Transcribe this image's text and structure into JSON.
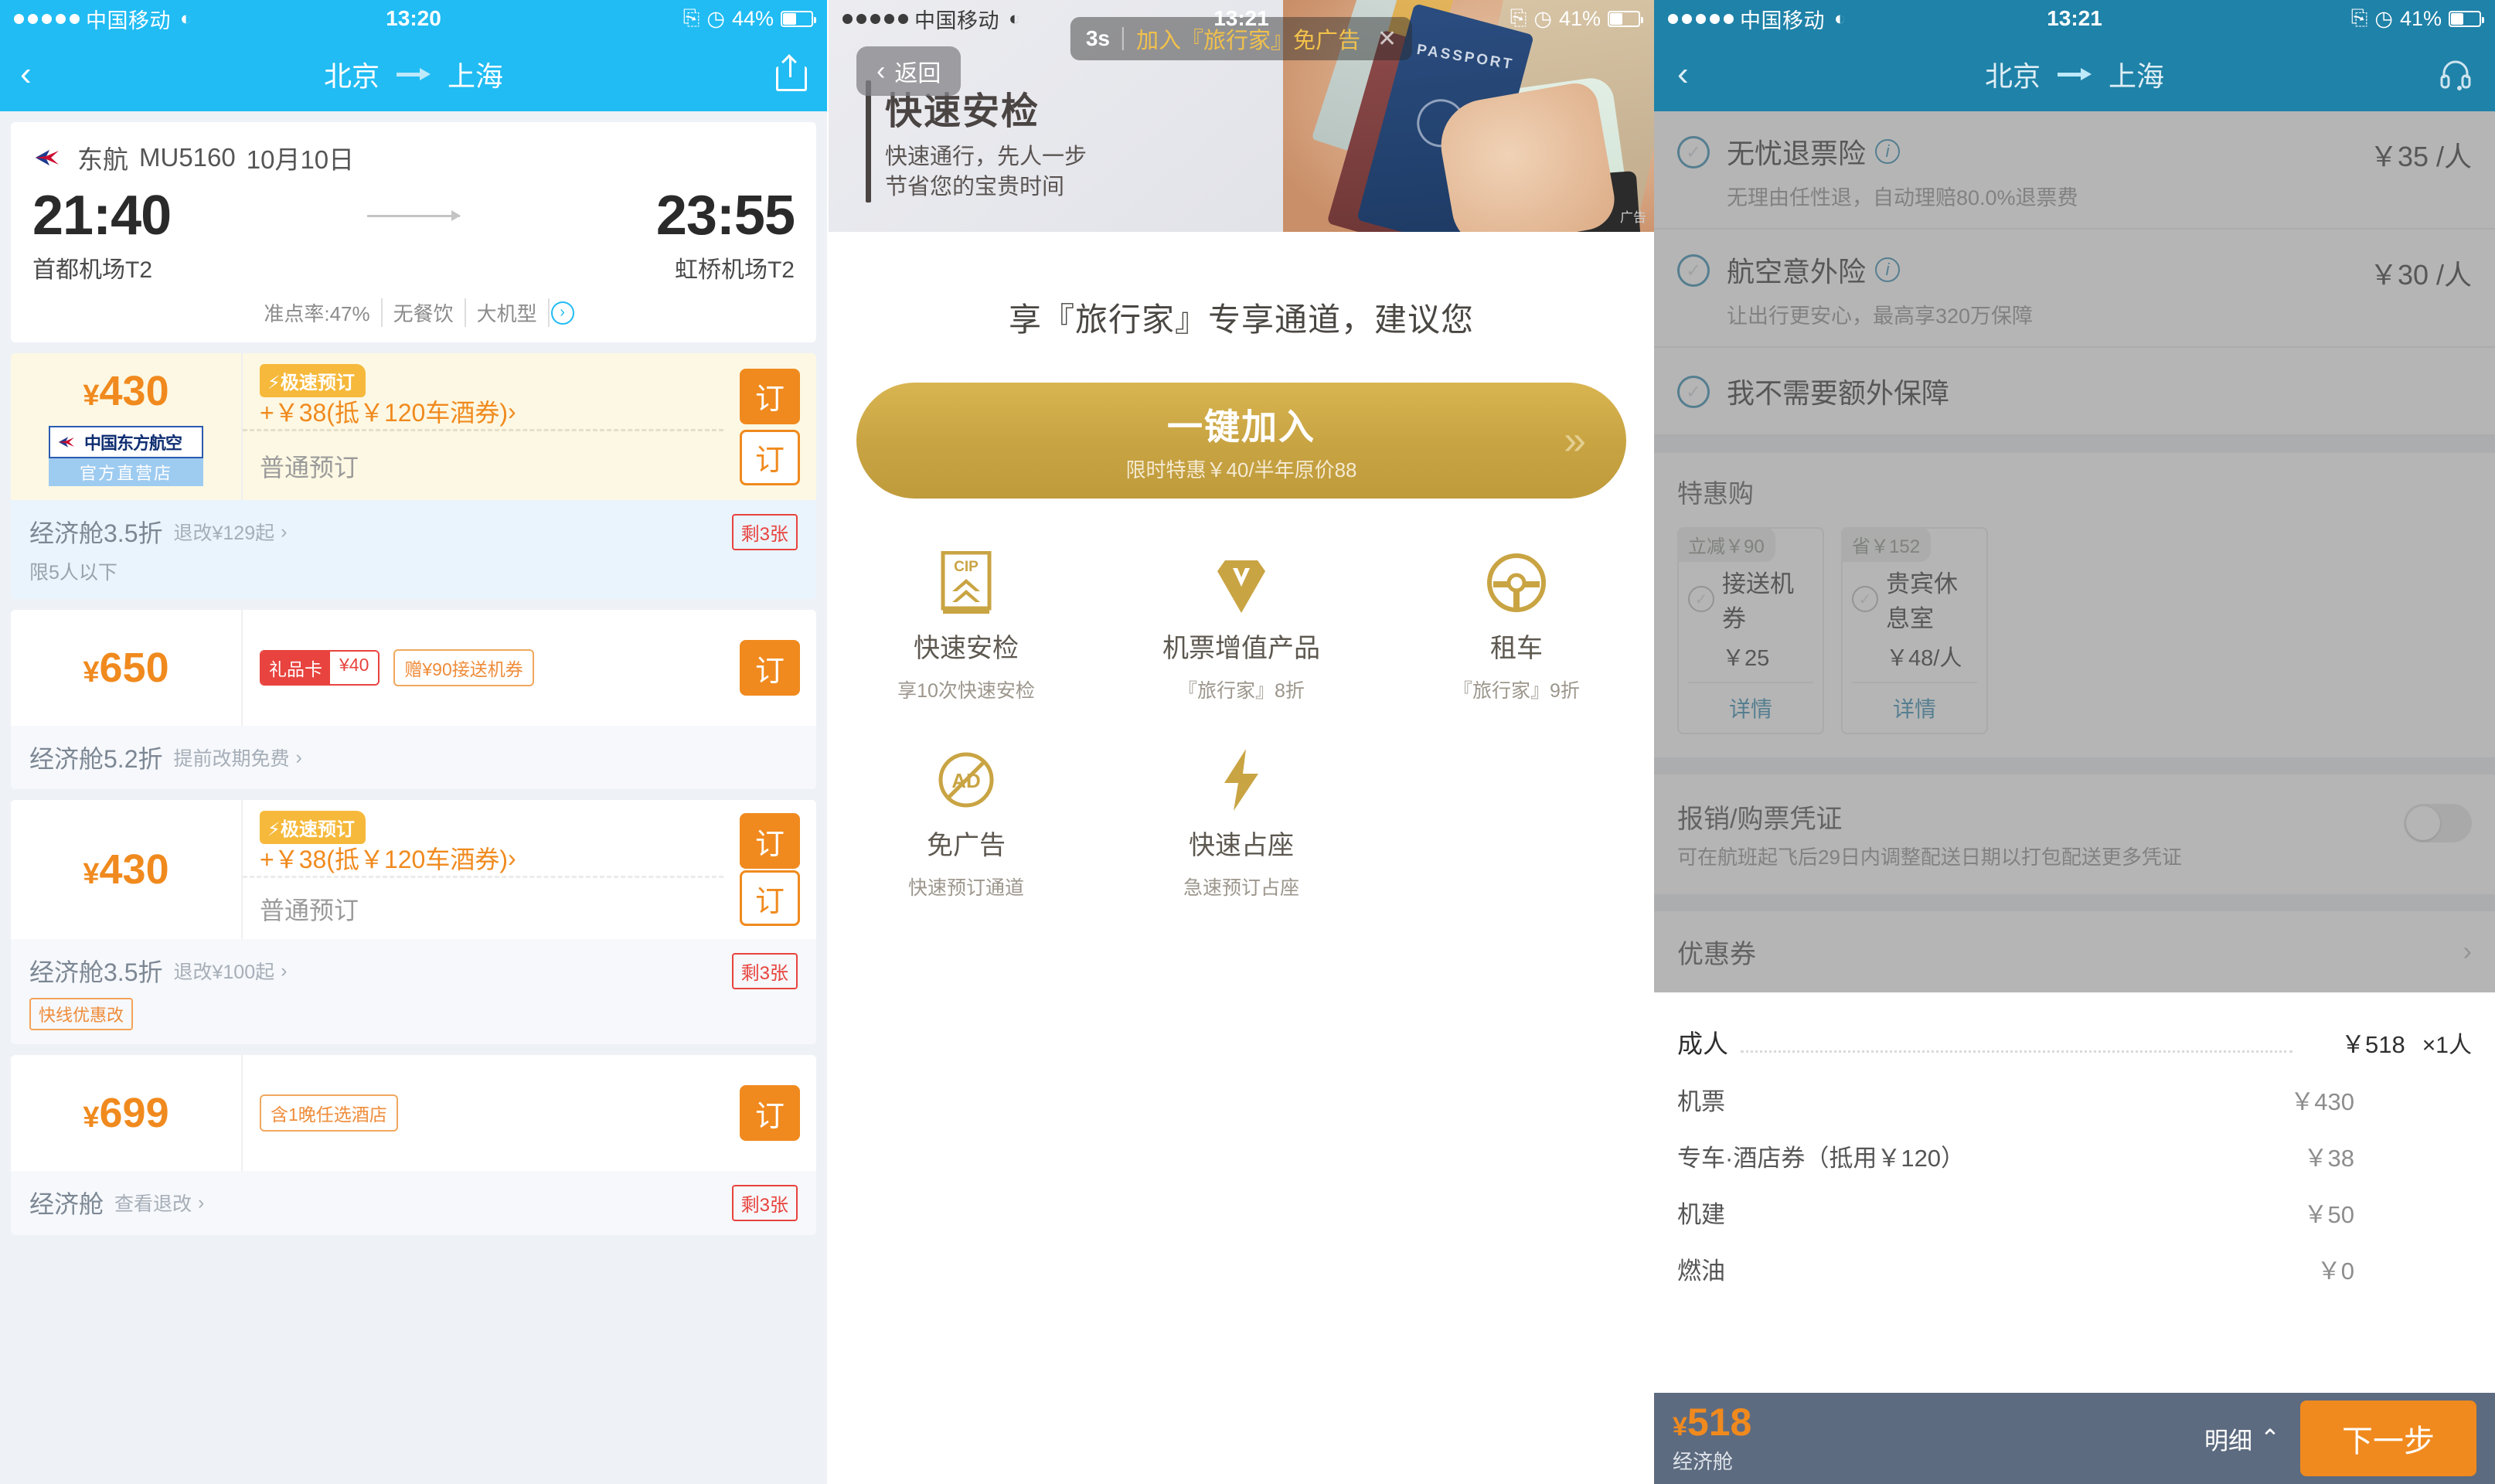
{
  "screen1": {
    "statusbar": {
      "carrier": "中国移动",
      "time": "13:20",
      "battery": "44%"
    },
    "nav": {
      "back_icon": "chevron-left",
      "from": "北京",
      "to": "上海",
      "share_icon": "share"
    },
    "flight": {
      "airline": "东航",
      "flight_no": "MU5160",
      "date": "10月10日",
      "dep_time": "21:40",
      "arr_time": "23:55",
      "dep_port": "首都机场T2",
      "arr_port": "虹桥机场T2",
      "meta": [
        "准点率:47%",
        "无餐饮",
        "大机型"
      ]
    },
    "fares": [
      {
        "price": "430",
        "currency": "¥",
        "badge_top": "中国东方航空",
        "badge_bottom": "官方直营店",
        "speed_tag": "⚡极速预订",
        "offer": "+￥38(抵￥120车酒券)",
        "offer_chevron": "›",
        "normal_label": "普通预订",
        "book_label": "订",
        "book_label2": "订",
        "cabin": "经济舱3.5折",
        "refund": "退改¥129起",
        "limit": "限5人以下",
        "left": "剩3张"
      },
      {
        "price": "650",
        "currency": "¥",
        "gift_a": "礼品卡",
        "gift_b": "¥40",
        "tag_plain": "赠¥90接送机券",
        "book_label": "订",
        "cabin": "经济舱5.2折",
        "refund": "提前改期免费"
      },
      {
        "price": "430",
        "currency": "¥",
        "speed_tag": "⚡极速预订",
        "offer": "+￥38(抵￥120车酒券)",
        "offer_chevron": "›",
        "normal_label": "普通预订",
        "book_label": "订",
        "book_label2": "订",
        "cabin": "经济舱3.5折",
        "refund": "退改¥100起",
        "change_tag": "快线优惠改",
        "left": "剩3张"
      },
      {
        "price": "699",
        "currency": "¥",
        "tag_plain": "含1晚任选酒店",
        "book_label": "订",
        "cabin": "经济舱",
        "refund": "查看退改",
        "left": "剩3张"
      }
    ]
  },
  "screen2": {
    "statusbar": {
      "carrier": "中国移动",
      "time": "13:21",
      "battery": "41%"
    },
    "back_label": "返回",
    "ad_pill": {
      "seconds": "3s",
      "text": "加入『旅行家』免广告",
      "close_icon": "close"
    },
    "ad_mark": "广告",
    "hero": {
      "title": "快速安检",
      "line1": "快速通行，先人一步",
      "line2": "节省您的宝贵时间"
    },
    "headline": "享『旅行家』专享通道，建议您",
    "join": {
      "label": "一键加入",
      "sub": "限时特惠￥40/半年原价88",
      "chevron": "»"
    },
    "features": [
      {
        "icon": "cip-icon",
        "title": "快速安检",
        "desc": "享10次快速安检"
      },
      {
        "icon": "diamond-icon",
        "title": "机票增值产品",
        "desc": "『旅行家』8折"
      },
      {
        "icon": "steering-icon",
        "title": "租车",
        "desc": "『旅行家』9折"
      },
      {
        "icon": "no-ads-icon",
        "title": "免广告",
        "desc": "快速预订通道"
      },
      {
        "icon": "lightning-icon",
        "title": "快速占座",
        "desc": "急速预订占座"
      }
    ]
  },
  "screen3": {
    "statusbar": {
      "carrier": "中国移动",
      "time": "13:21",
      "battery": "41%"
    },
    "nav": {
      "back_icon": "chevron-left",
      "from": "北京",
      "to": "上海",
      "support_icon": "headset"
    },
    "insurance": [
      {
        "title": "无忧退票险",
        "sub": "无理由任性退，自动理赔80.0%退票费",
        "price": "￥35 /人"
      },
      {
        "title": "航空意外险",
        "sub": "让出行更安心，最高享320万保障",
        "price": "￥30 /人"
      },
      {
        "title": "我不需要额外保障",
        "sub": "",
        "price": ""
      }
    ],
    "promo": {
      "heading": "特惠购",
      "cards": [
        {
          "tag": "立减￥90",
          "name": "接送机券",
          "price": "￥25",
          "detail": "详情"
        },
        {
          "tag": "省￥152",
          "name": "贵宾休息室",
          "price": "￥48/人",
          "detail": "详情"
        }
      ]
    },
    "invoice": {
      "title": "报销/购票凭证",
      "desc": "可在航班起飞后29日内调整配送日期以打包配送更多凭证",
      "toggle_state": "off"
    },
    "coupon": {
      "title": "优惠券",
      "chevron": "›"
    },
    "breakdown": {
      "main": {
        "label": "成人",
        "value": "￥518",
        "count": "×1人"
      },
      "rows": [
        {
          "label": "机票",
          "value": "￥430"
        },
        {
          "label": "专车·酒店券（抵用￥120）",
          "value": "￥38"
        },
        {
          "label": "机建",
          "value": "￥50"
        },
        {
          "label": "燃油",
          "value": "￥0"
        }
      ]
    },
    "bottombar": {
      "currency": "¥",
      "total": "518",
      "cabin": "经济舱",
      "detail_label": "明细",
      "detail_chevron": "⌃",
      "next_label": "下一步"
    }
  },
  "colors": {
    "blue_nav": "#21bcf3",
    "teal_nav": "#1f82a8",
    "orange": "#f08a1e",
    "gold": "#c9a443",
    "red": "#e8433e"
  }
}
